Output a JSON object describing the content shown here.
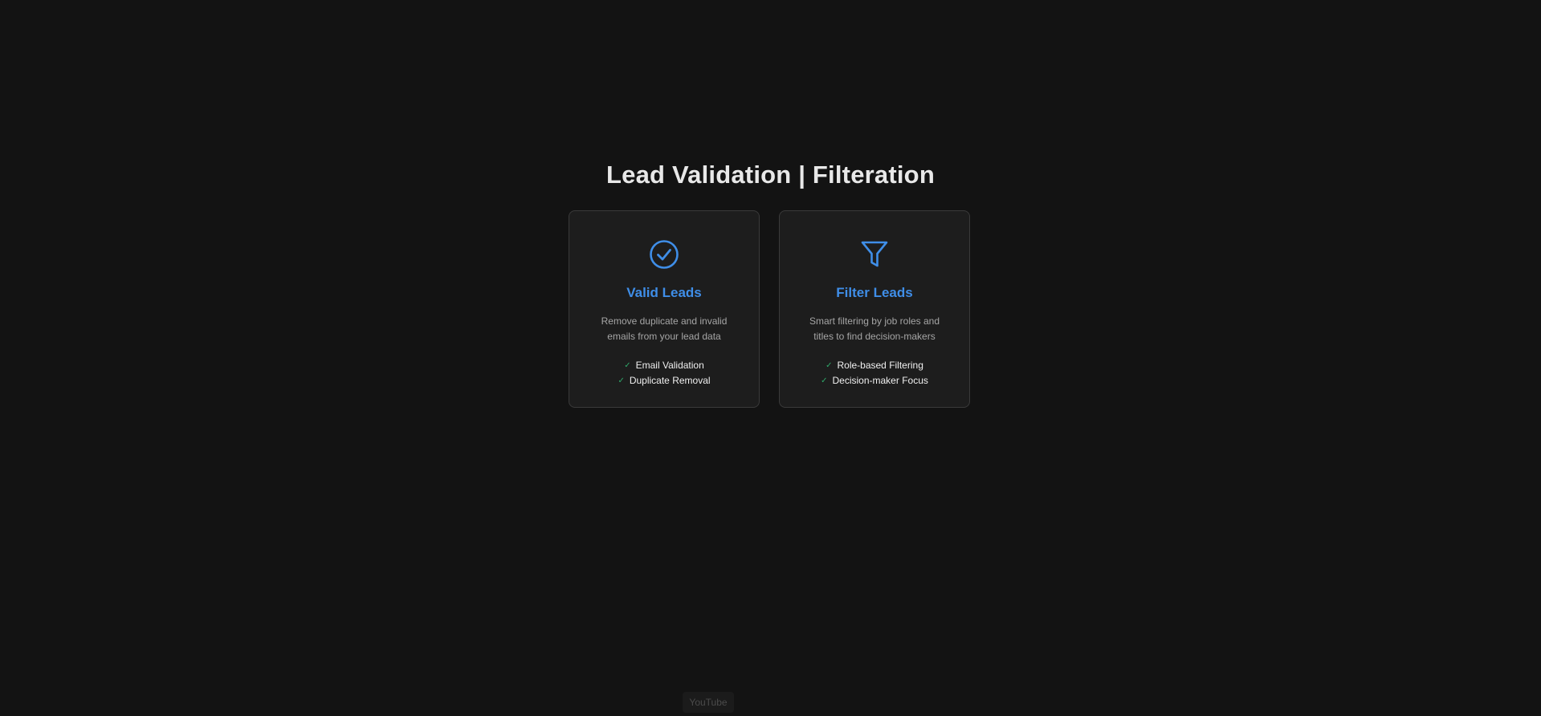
{
  "page": {
    "title": "Lead Validation | Filteration"
  },
  "colors": {
    "background": "#131313",
    "card_background": "#1d1d1d",
    "card_border": "#3a3a3a",
    "accent": "#3f8ee8",
    "check_green": "#2fa86a",
    "description_text": "#a6a6a6"
  },
  "cards": [
    {
      "icon": "check-circle-icon",
      "title": "Valid Leads",
      "description": "Remove duplicate and invalid emails from your lead data",
      "features": [
        "Email Validation",
        "Duplicate Removal"
      ]
    },
    {
      "icon": "funnel-filter-icon",
      "title": "Filter Leads",
      "description": "Smart filtering by job roles and titles to find decision-makers",
      "features": [
        "Role-based Filtering",
        "Decision-maker Focus"
      ]
    }
  ],
  "check_glyph": "✓",
  "footer": {
    "label": "YouTube"
  }
}
